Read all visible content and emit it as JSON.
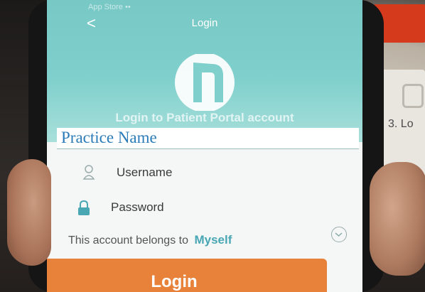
{
  "status_bar": {
    "text": "App Store ••"
  },
  "header": {
    "back_glyph": "<",
    "title": "Login",
    "subtitle": "Login to Patient Portal account"
  },
  "banner": {
    "practice_name": "Practice Name"
  },
  "form": {
    "username_placeholder": "Username",
    "password_placeholder": "Password",
    "belongs_label": "This account belongs to",
    "belongs_value": "Myself"
  },
  "login_button": {
    "label": "Login"
  },
  "background": {
    "doc_text": "3. Lo"
  },
  "icons": {
    "back": "back-arrow-icon",
    "logo": "portal-logo-icon",
    "user": "user-icon",
    "lock": "lock-icon",
    "dropdown": "chevron-down-icon"
  },
  "colors": {
    "header": "#7fd0cc",
    "accent": "#49a7b4",
    "button": "#e8823a",
    "practice_name": "#2b7bb8"
  }
}
